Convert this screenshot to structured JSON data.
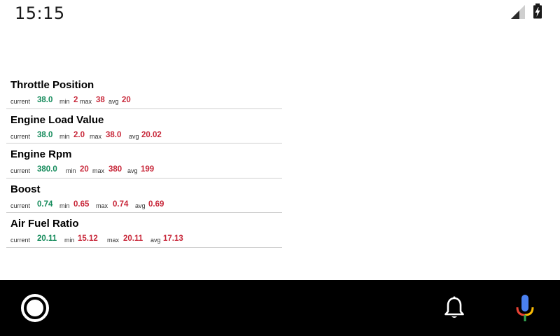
{
  "status_bar": {
    "time": "15:15",
    "signal_icon": "cell-signal-icon",
    "battery_icon": "battery-charging-icon"
  },
  "metrics": [
    {
      "name": "Throttle Position",
      "current_label": "current",
      "current": "38.0",
      "min_label": "min",
      "min": "2",
      "max_label": "max",
      "max": "38",
      "avg_label": "avg",
      "avg": "20"
    },
    {
      "name": "Engine Load Value",
      "current_label": "current",
      "current": "38.0",
      "min_label": "min",
      "min": "2.0",
      "max_label": "max",
      "max": "38.0",
      "avg_label": "avg",
      "avg": "20.02"
    },
    {
      "name": "Engine Rpm",
      "current_label": "current",
      "current": "380.0",
      "min_label": "min",
      "min": "20",
      "max_label": "max",
      "max": "380",
      "avg_label": "avg",
      "avg": "199"
    },
    {
      "name": "Boost",
      "current_label": "current",
      "current": "0.74",
      "min_label": "min",
      "min": "0.65",
      "max_label": "max",
      "max": "0.74",
      "avg_label": "avg",
      "avg": "0.69"
    },
    {
      "name": "Air Fuel Ratio",
      "current_label": "current",
      "current": "20.11",
      "min_label": "min",
      "min": "15.12",
      "max_label": "max",
      "max": "20.11",
      "avg_label": "avg",
      "avg": "17.13"
    }
  ],
  "colors": {
    "current_value": "#138a5a",
    "stat_value": "#c8283a",
    "nav_background": "#000000"
  },
  "nav_bar": {
    "home_icon": "home-circle-icon",
    "notification_icon": "bell-icon",
    "voice_icon": "microphone-icon"
  }
}
